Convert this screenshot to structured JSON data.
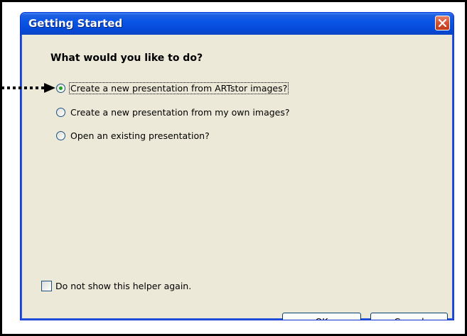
{
  "dialog": {
    "title": "Getting Started",
    "question": "What would you like to do?",
    "options": [
      {
        "label": "Create a new presentation from ARTstor images?",
        "selected": true
      },
      {
        "label": "Create a new presentation from my own images?",
        "selected": false
      },
      {
        "label": "Open an existing presentation?",
        "selected": false
      }
    ],
    "checkbox": {
      "label": "Do not show this helper again.",
      "checked": false
    },
    "buttons": {
      "ok_label": "OK",
      "cancel_label": "Cancel"
    }
  },
  "colors": {
    "titlebar": "#0a55e6",
    "dialog_bg": "#ece9d8",
    "close_button": "#d6512f",
    "radio_dot": "#21a121"
  },
  "icons": [
    "close-icon",
    "pointer-arrow-icon"
  ]
}
